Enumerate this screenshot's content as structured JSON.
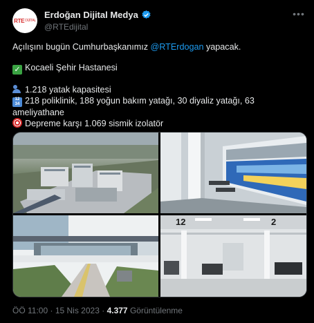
{
  "account": {
    "avatar_text": "RTE",
    "avatar_text2": "DİJİTAL",
    "name": "Erdoğan Dijital Medya",
    "handle": "@RTEdijital"
  },
  "tweet": {
    "line1_prefix": "Açılışını bugün Cumhurbaşkanımız ",
    "mention": "@RTErdogan",
    "line1_suffix": " yapacak.",
    "hospital": "Kocaeli Şehir Hastanesi",
    "beds": "1.218 yatak kapasitesi",
    "details": "218 poliklinik, 188 yoğun bakım yatağı, 30 diyaliz yatağı, 63 ameliyathane",
    "isolators": "Depreme karşı 1.069 sismik izolatör"
  },
  "icons": {
    "verified": "verified-badge-icon",
    "more": "more-options-icon",
    "check": "check-mark-emoji-icon",
    "people": "people-emoji-icon",
    "numbers": "numbers-emoji-icon",
    "target": "target-emoji-icon"
  },
  "media": {
    "photo1": "Aerial view of hospital complex",
    "photo2": "Hospital atrium interior",
    "photo3": "Hospital entrance walkway",
    "photo4": "Hospital ward with numbered beds",
    "ward_label_left": "12",
    "ward_label_right": "2"
  },
  "meta": {
    "time": "ÖÖ 11:00",
    "separator": "·",
    "date": "15 Nis 2023",
    "views_count": "4.377",
    "views_label": "Görüntülenme"
  },
  "colors": {
    "background": "#000000",
    "text": "#e7e9ea",
    "muted": "#71767b",
    "link": "#1d9bf0",
    "verified": "#1d9bf0"
  }
}
